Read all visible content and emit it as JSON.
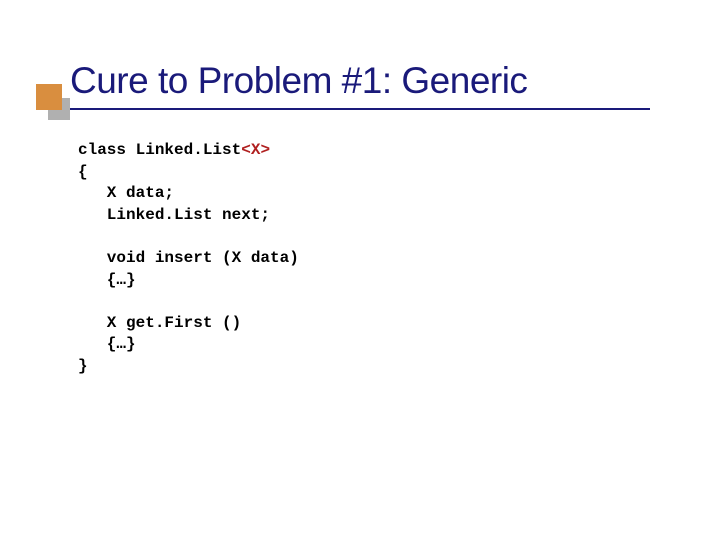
{
  "slide": {
    "title": "Cure to Problem #1: Generic"
  },
  "code": {
    "l1a": "class Linked.List",
    "l1b": "<X>",
    "l2": "{",
    "l3": "   X data;",
    "l4": "   Linked.List next;",
    "l5": "",
    "l6": "   void insert (X data)",
    "l7": "   {…}",
    "l8": "",
    "l9": "   X get.First ()",
    "l10": "   {…}",
    "l11": "}"
  }
}
